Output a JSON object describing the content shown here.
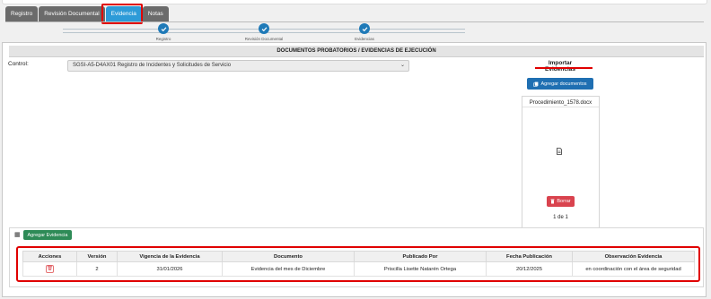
{
  "tabs": [
    {
      "label": "Registro",
      "active": false
    },
    {
      "label": "Revisión Documental",
      "active": false
    },
    {
      "label": "Evidencia",
      "active": true
    },
    {
      "label": "Notas",
      "active": false
    }
  ],
  "stepper": [
    {
      "label": "Registro",
      "completed": true
    },
    {
      "label": "Revisión Documental",
      "completed": true
    },
    {
      "label": "Evidencias",
      "completed": true
    }
  ],
  "section_title": "DOCUMENTOS PROBATORIOS / EVIDENCIAS DE EJECUCIÓN",
  "control": {
    "label": "Control:",
    "selected": "SGSI-A5-D4AX01 Registro de Incidentes y Solicitudes de Servicio"
  },
  "import": {
    "title": "Importar Evidencias",
    "add_button": "Agregar documentos",
    "file_name": "Procedimiento_1578.docx",
    "delete_button": "Borrar",
    "pagination": "1 de 1"
  },
  "evidence": {
    "add_button": "Agregar Evidencia",
    "columns": [
      "Acciones",
      "Versión",
      "Vigencia de la Evidencia",
      "Documento",
      "Publicado Por",
      "Fecha Publicación",
      "Observación Evidencia"
    ],
    "rows": [
      {
        "version": "2",
        "validity": "31/01/2026",
        "document": "Evidencia del mes de Diciembre",
        "published_by": "Priscilla Lisette Natarén Ortega",
        "publish_date": "20/12/2025",
        "observation": "en coordinación con el área de seguridad"
      }
    ]
  },
  "colors": {
    "tab_active": "#2d9bd8",
    "tab_inactive": "#6b6b6b",
    "primary": "#1f6fb2",
    "success": "#2e8b57",
    "danger": "#d9434e",
    "highlight": "#e00000"
  },
  "icons": {
    "step": "check-icon",
    "add_documents": "copy-icon",
    "file": "file-icon",
    "delete": "trash-icon",
    "evidence_panel": "table-icon"
  }
}
